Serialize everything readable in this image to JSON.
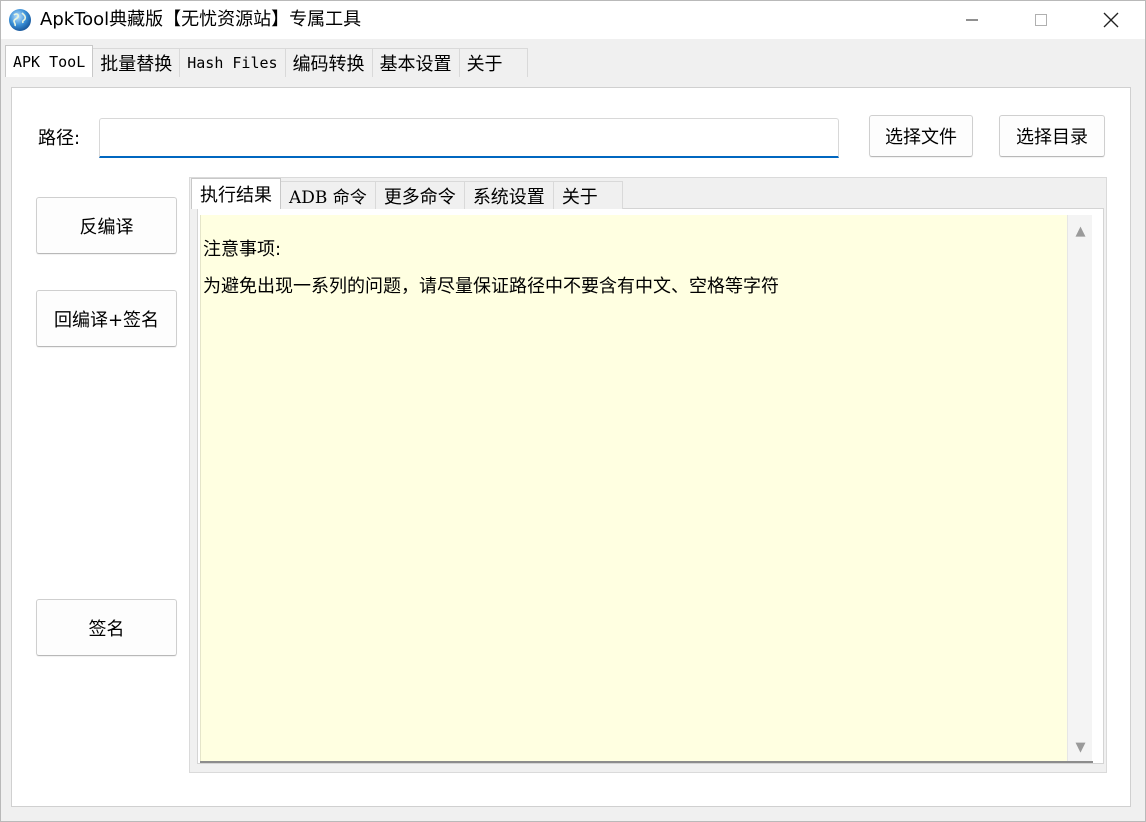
{
  "window": {
    "title": "ApkTool典藏版【无忧资源站】专属工具",
    "icon": "globe-icon",
    "controls": {
      "minimize": "minimize-icon",
      "maximize": "maximize-icon",
      "close": "close-icon"
    }
  },
  "top_tabs": [
    {
      "label": "APK TooL",
      "active": true
    },
    {
      "label": "批量替换",
      "active": false
    },
    {
      "label": "Hash Files",
      "active": false
    },
    {
      "label": "编码转换",
      "active": false
    },
    {
      "label": "基本设置",
      "active": false
    },
    {
      "label": "关于",
      "active": false
    }
  ],
  "path": {
    "label": "路径:",
    "value": "",
    "select_file": "选择文件",
    "select_dir": "选择目录"
  },
  "actions": {
    "decompile": "反编译",
    "recompile_sign": "回编译+签名",
    "sign": "签名"
  },
  "inner_tabs": [
    {
      "label": "执行结果",
      "active": true
    },
    {
      "label": "ADB 命令",
      "active": false
    },
    {
      "label": "更多命令",
      "active": false
    },
    {
      "label": "系统设置",
      "active": false
    },
    {
      "label": "关于",
      "active": false
    }
  ],
  "output": {
    "lines": [
      "注意事项:",
      "为避免出现一系列的问题，请尽量保证路径中不要含有中文、空格等字符"
    ]
  },
  "colors": {
    "accent": "#0067c0",
    "output_bg": "#ffffe1"
  }
}
